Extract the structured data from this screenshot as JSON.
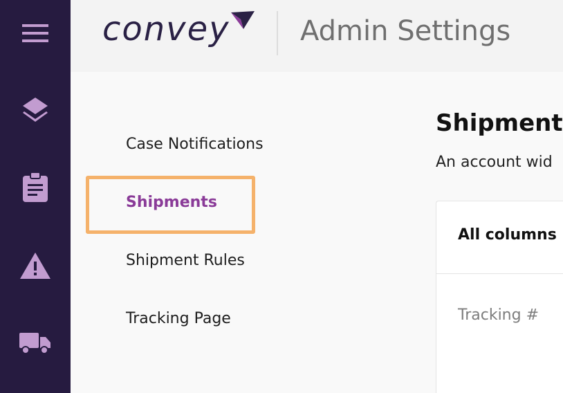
{
  "app": {
    "brand": "convey",
    "page_title": "Admin Settings"
  },
  "rail": {
    "icons": [
      "menu-icon",
      "layers-icon",
      "clipboard-icon",
      "warning-icon",
      "truck-icon"
    ],
    "icon_color": "#c29cd0",
    "background": "#261b40"
  },
  "subnav": {
    "items": [
      {
        "label": "Case Notifications",
        "active": false
      },
      {
        "label": "Shipments",
        "active": true
      },
      {
        "label": "Shipment Rules",
        "active": false
      },
      {
        "label": "Tracking Page",
        "active": false
      }
    ],
    "active_color": "#8a3b98",
    "highlight_color": "#f5b26b"
  },
  "main": {
    "title": "Shipments",
    "description": "An account wid",
    "card": {
      "header": "All columns",
      "column": "Tracking #"
    }
  }
}
